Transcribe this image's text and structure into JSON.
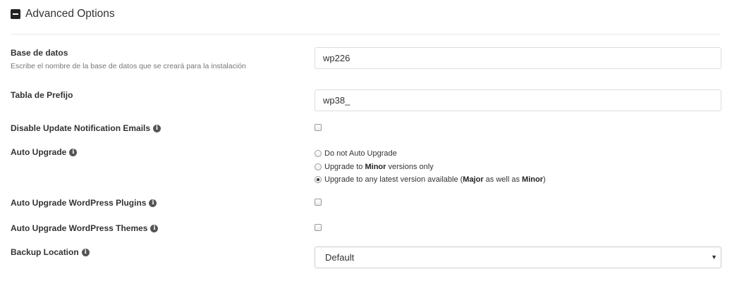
{
  "section": {
    "title": "Advanced Options"
  },
  "database": {
    "label": "Base de datos",
    "help": "Escribe el nombre de la base de datos que se creará para la instalación",
    "value": "wp226"
  },
  "prefix": {
    "label": "Tabla de Prefijo",
    "value": "wp38_"
  },
  "disable_emails": {
    "label": "Disable Update Notification Emails",
    "checked": false
  },
  "auto_upgrade": {
    "label": "Auto Upgrade",
    "options": {
      "none": {
        "label": "Do not Auto Upgrade",
        "checked": false
      },
      "minor": {
        "prefix": "Upgrade to ",
        "bold": "Minor",
        "suffix": " versions only",
        "checked": false
      },
      "any": {
        "prefix": "Upgrade to any latest version available (",
        "bold1": "Major",
        "middle": " as well as ",
        "bold2": "Minor",
        "suffix": ")",
        "checked": true
      }
    }
  },
  "auto_plugins": {
    "label": "Auto Upgrade WordPress Plugins",
    "checked": false
  },
  "auto_themes": {
    "label": "Auto Upgrade WordPress Themes",
    "checked": false
  },
  "backup": {
    "label": "Backup Location",
    "selected": "Default"
  },
  "icons": {
    "collapse": "minus-square-icon",
    "info": "info-circle-icon",
    "dropdown": "caret-down-icon",
    "info_glyph": "i",
    "arrow_glyph": "▼"
  }
}
